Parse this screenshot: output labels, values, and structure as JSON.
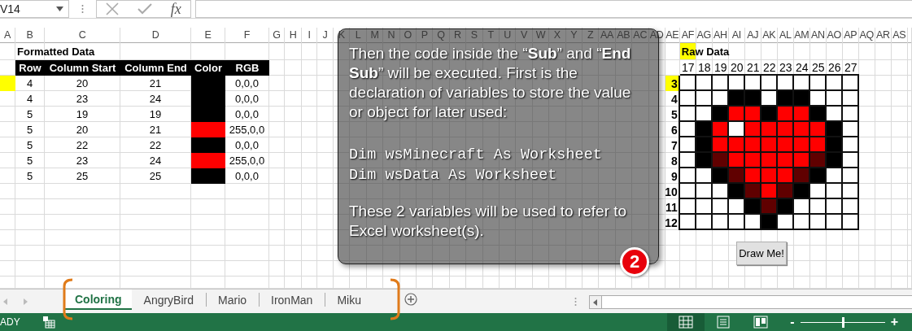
{
  "formula_bar": {
    "name_box": "V14",
    "function_label": "fx"
  },
  "column_headers": [
    "A",
    "B",
    "C",
    "D",
    "E",
    "F",
    "G",
    "H",
    "I",
    "J",
    "K",
    "L",
    "M",
    "N",
    "O",
    "P",
    "Q",
    "R",
    "S",
    "T",
    "U",
    "V",
    "W",
    "X",
    "Y",
    "Z",
    "AA",
    "AB",
    "AC",
    "AD",
    "AE",
    "AF",
    "AG",
    "AH",
    "AI",
    "AJ",
    "AK",
    "AL",
    "AM",
    "AN",
    "AO",
    "AP",
    "AQ",
    "AR",
    "AS"
  ],
  "formatted_data": {
    "title": "Formatted Data",
    "columns": [
      "Row",
      "Column Start",
      "Column End",
      "Color",
      "RGB"
    ],
    "rows": [
      {
        "row": "4",
        "column_start": "20",
        "column_end": "21",
        "color": "#000000",
        "rgb": "0,0,0",
        "highlighted": true
      },
      {
        "row": "4",
        "column_start": "23",
        "column_end": "24",
        "color": "#000000",
        "rgb": "0,0,0",
        "highlighted": false
      },
      {
        "row": "5",
        "column_start": "19",
        "column_end": "19",
        "color": "#000000",
        "rgb": "0,0,0",
        "highlighted": false
      },
      {
        "row": "5",
        "column_start": "20",
        "column_end": "21",
        "color": "#ff0000",
        "rgb": "255,0,0",
        "highlighted": false
      },
      {
        "row": "5",
        "column_start": "22",
        "column_end": "22",
        "color": "#000000",
        "rgb": "0,0,0",
        "highlighted": false
      },
      {
        "row": "5",
        "column_start": "23",
        "column_end": "24",
        "color": "#ff0000",
        "rgb": "255,0,0",
        "highlighted": false
      },
      {
        "row": "5",
        "column_start": "25",
        "column_end": "25",
        "color": "#000000",
        "rgb": "0,0,0",
        "highlighted": false
      }
    ]
  },
  "raw_data": {
    "title": "Raw Data",
    "title_highlighted": true,
    "column_numbers": [
      "17",
      "18",
      "19",
      "20",
      "21",
      "22",
      "23",
      "24",
      "25",
      "26",
      "27"
    ],
    "rows": [
      {
        "label": "3",
        "highlighted": true,
        "cells": [
          {
            "color": "#ffffff"
          },
          {
            "color": "#ffffff"
          },
          {
            "color": "#ffffff"
          },
          {
            "color": "#ffffff"
          },
          {
            "color": "#ffffff"
          },
          {
            "color": "#ffffff"
          },
          {
            "color": "#ffffff"
          },
          {
            "color": "#ffffff"
          },
          {
            "color": "#ffffff"
          },
          {
            "color": "#ffffff"
          },
          {
            "color": "#ffffff"
          }
        ]
      },
      {
        "label": "4",
        "highlighted": false,
        "cells": [
          {
            "color": "#ffffff"
          },
          {
            "color": "#ffffff"
          },
          {
            "color": "#ffffff"
          },
          {
            "color": "#000000"
          },
          {
            "color": "#000000"
          },
          {
            "color": "#ffffff"
          },
          {
            "color": "#000000"
          },
          {
            "color": "#000000"
          },
          {
            "color": "#ffffff"
          },
          {
            "color": "#ffffff"
          },
          {
            "color": "#ffffff"
          }
        ]
      },
      {
        "label": "5",
        "highlighted": false,
        "cells": [
          {
            "color": "#ffffff"
          },
          {
            "color": "#ffffff"
          },
          {
            "color": "#000000"
          },
          {
            "color": "#ff0000"
          },
          {
            "color": "#ff0000"
          },
          {
            "color": "#000000"
          },
          {
            "color": "#ff0000"
          },
          {
            "color": "#ff0000"
          },
          {
            "color": "#000000"
          },
          {
            "color": "#ffffff"
          },
          {
            "color": "#ffffff"
          }
        ]
      },
      {
        "label": "6",
        "highlighted": false,
        "cells": [
          {
            "color": "#ffffff"
          },
          {
            "color": "#000000"
          },
          {
            "color": "#ff0000"
          },
          {
            "color": "#ffffff"
          },
          {
            "color": "#ff0000"
          },
          {
            "color": "#ff0000"
          },
          {
            "color": "#ff0000"
          },
          {
            "color": "#ff0000"
          },
          {
            "color": "#ff0000"
          },
          {
            "color": "#000000"
          },
          {
            "color": "#ffffff"
          }
        ]
      },
      {
        "label": "7",
        "highlighted": false,
        "cells": [
          {
            "color": "#ffffff"
          },
          {
            "color": "#000000"
          },
          {
            "color": "#ff0000"
          },
          {
            "color": "#ff0000"
          },
          {
            "color": "#ff0000"
          },
          {
            "color": "#ff0000"
          },
          {
            "color": "#ff0000"
          },
          {
            "color": "#ff0000"
          },
          {
            "color": "#ff0000"
          },
          {
            "color": "#000000"
          },
          {
            "color": "#ffffff"
          }
        ]
      },
      {
        "label": "8",
        "highlighted": false,
        "cells": [
          {
            "color": "#ffffff"
          },
          {
            "color": "#000000"
          },
          {
            "color": "#600000"
          },
          {
            "color": "#ff0000"
          },
          {
            "color": "#ff0000"
          },
          {
            "color": "#ff0000"
          },
          {
            "color": "#ff0000"
          },
          {
            "color": "#ff0000"
          },
          {
            "color": "#600000"
          },
          {
            "color": "#000000"
          },
          {
            "color": "#ffffff"
          }
        ]
      },
      {
        "label": "9",
        "highlighted": false,
        "cells": [
          {
            "color": "#ffffff"
          },
          {
            "color": "#ffffff"
          },
          {
            "color": "#000000"
          },
          {
            "color": "#600000"
          },
          {
            "color": "#ff0000"
          },
          {
            "color": "#ff0000"
          },
          {
            "color": "#ff0000"
          },
          {
            "color": "#600000"
          },
          {
            "color": "#000000"
          },
          {
            "color": "#ffffff"
          },
          {
            "color": "#ffffff"
          }
        ]
      },
      {
        "label": "10",
        "highlighted": false,
        "cells": [
          {
            "color": "#ffffff"
          },
          {
            "color": "#ffffff"
          },
          {
            "color": "#ffffff"
          },
          {
            "color": "#000000"
          },
          {
            "color": "#600000"
          },
          {
            "color": "#ff0000"
          },
          {
            "color": "#600000"
          },
          {
            "color": "#000000"
          },
          {
            "color": "#ffffff"
          },
          {
            "color": "#ffffff"
          },
          {
            "color": "#ffffff"
          }
        ]
      },
      {
        "label": "11",
        "highlighted": false,
        "cells": [
          {
            "color": "#ffffff"
          },
          {
            "color": "#ffffff"
          },
          {
            "color": "#ffffff"
          },
          {
            "color": "#ffffff"
          },
          {
            "color": "#000000"
          },
          {
            "color": "#600000"
          },
          {
            "color": "#000000"
          },
          {
            "color": "#ffffff"
          },
          {
            "color": "#ffffff"
          },
          {
            "color": "#ffffff"
          },
          {
            "color": "#ffffff"
          }
        ]
      },
      {
        "label": "12",
        "highlighted": false,
        "cells": [
          {
            "color": "#ffffff"
          },
          {
            "color": "#ffffff"
          },
          {
            "color": "#ffffff"
          },
          {
            "color": "#ffffff"
          },
          {
            "color": "#ffffff"
          },
          {
            "color": "#000000"
          },
          {
            "color": "#ffffff"
          },
          {
            "color": "#ffffff"
          },
          {
            "color": "#ffffff"
          },
          {
            "color": "#ffffff"
          },
          {
            "color": "#ffffff"
          }
        ]
      }
    ]
  },
  "draw_button": "Draw Me!",
  "callout": {
    "paragraphs": [
      "Then the code inside the “**Sub**” and “**End Sub**” will be executed. First is the declaration of variables to store the value or object for later used:",
      "These 2 variables will be used to refer to Excel worksheet(s)."
    ],
    "code": [
      "Dim wsMinecraft As Worksheet",
      "Dim wsData As Worksheet"
    ],
    "badge": "2"
  },
  "sheet_tabs": [
    {
      "label": "Coloring",
      "selected": true
    },
    {
      "label": "AngryBird",
      "selected": false
    },
    {
      "label": "Mario",
      "selected": false
    },
    {
      "label": "IronMan",
      "selected": false
    },
    {
      "label": "Miku",
      "selected": false
    }
  ],
  "status_bar": {
    "mode": "ADY",
    "views": [
      {
        "kind": "normal",
        "selected": true
      },
      {
        "kind": "page_layout",
        "selected": false
      },
      {
        "kind": "page_break",
        "selected": false
      }
    ],
    "zoom_out": "-",
    "zoom_in": "+",
    "zoom": {
      "level": 0.5
    }
  }
}
